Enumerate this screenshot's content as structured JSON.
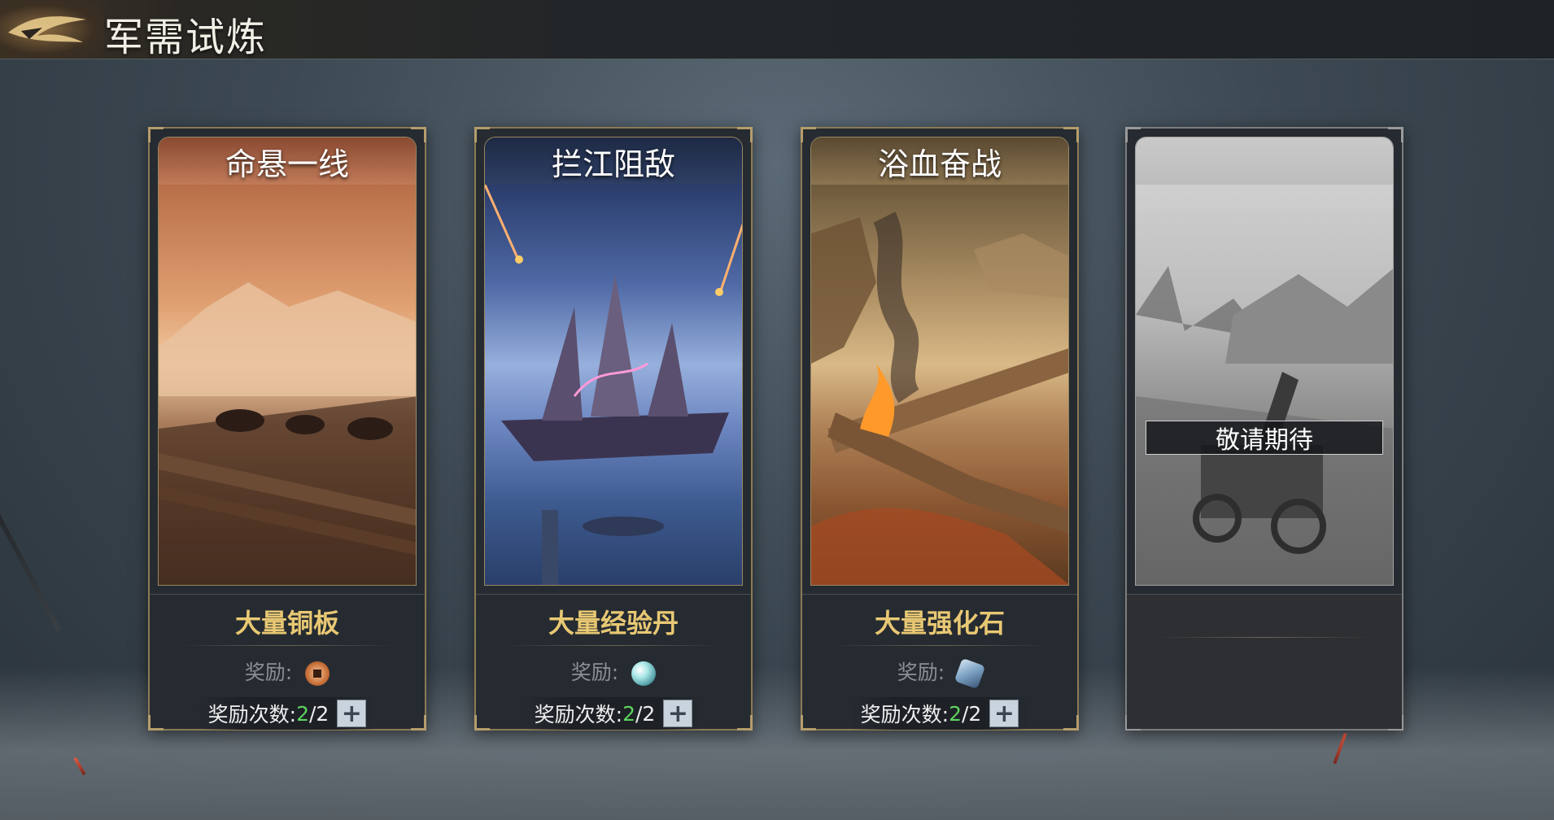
{
  "header": {
    "title": "军需试炼",
    "emblem_icon": "bird-emblem-icon"
  },
  "cards": [
    {
      "title": "命悬一线",
      "reward_name": "大量铜板",
      "reward_label": "奖励:",
      "reward_icon": "copper-coin-icon",
      "count_label": "奖励次数:",
      "count_current": "2",
      "count_total": "/2",
      "plus_label": "+"
    },
    {
      "title": "拦江阻敌",
      "reward_name": "大量经验丹",
      "reward_label": "奖励:",
      "reward_icon": "experience-pill-icon",
      "count_label": "奖励次数:",
      "count_current": "2",
      "count_total": "/2",
      "plus_label": "+"
    },
    {
      "title": "浴血奋战",
      "reward_name": "大量强化石",
      "reward_label": "奖励:",
      "reward_icon": "enhance-stone-icon",
      "count_label": "奖励次数:",
      "count_current": "2",
      "count_total": "/2",
      "plus_label": "+"
    },
    {
      "coming_soon": "敬请期待"
    }
  ],
  "colors": {
    "accent_gold": "#e8c873",
    "count_green": "#5fd35f",
    "frame_gold": "#8c7a55"
  }
}
